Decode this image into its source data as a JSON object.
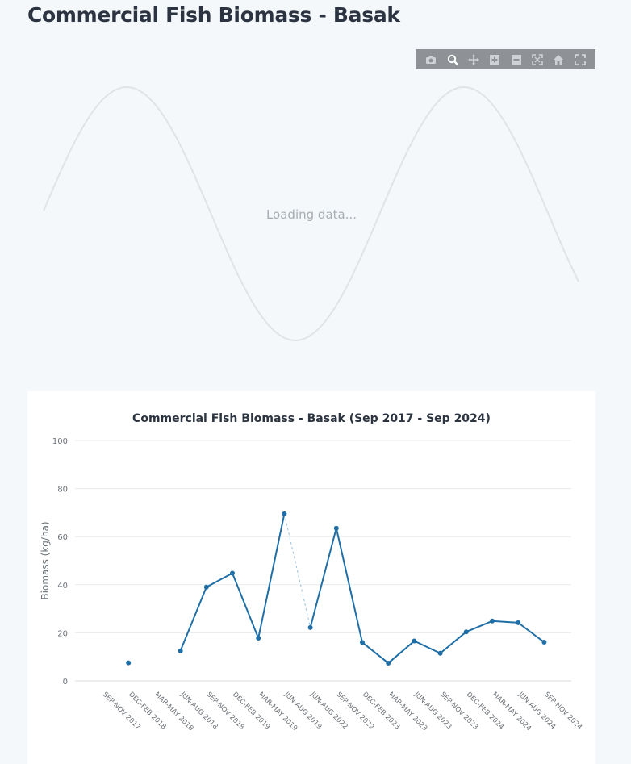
{
  "page": {
    "title": "Commercial Fish Biomass - Basak"
  },
  "loading": {
    "text": "Loading data..."
  },
  "modebar": {
    "icons": [
      "camera-icon",
      "zoom-icon",
      "pan-icon",
      "zoom-in-icon",
      "zoom-out-icon",
      "autoscale-icon",
      "home-icon",
      "fullscreen-icon"
    ],
    "background": "#8e9296",
    "active_icon_color": "#ffffff",
    "icon_color": "#cfd2d5"
  },
  "chart_data": {
    "type": "line",
    "title": "Commercial Fish Biomass - Basak (Sep 2017 - Sep 2024)",
    "xlabel": "",
    "ylabel": "Biomass (kg/ha)",
    "ylim": [
      0,
      100
    ],
    "yticks": [
      "0",
      "20",
      "40",
      "60",
      "80",
      "100"
    ],
    "grid": true,
    "color": "#1f6fa6",
    "categories": [
      "SEP-NOV 2017",
      "DEC-FEB 2018",
      "MAR-MAY 2018",
      "JUN-AUG 2018",
      "SEP-NOV 2018",
      "DEC-FEB 2019",
      "MAR-MAY 2019",
      "JUN-AUG 2019",
      "JUN-AUG 2022",
      "SEP-NOV 2022",
      "DEC-FEB 2023",
      "MAR-MAY 2023",
      "JUN-AUG 2023",
      "SEP-NOV 2023",
      "DEC-FEB 2024",
      "MAR-MAY 2024",
      "JUN-AUG 2024",
      "SEP-NOV 2024"
    ],
    "series": [
      {
        "values": [
          null,
          7.5,
          null,
          12.5,
          39,
          44.8,
          17.8,
          69.5,
          22.2,
          63.5,
          16,
          7.4,
          16.6,
          11.5,
          20.4,
          24.9,
          24.2,
          16.1
        ]
      }
    ],
    "gap_connector": {
      "from_index": 7,
      "to_index": 8,
      "style": "dashed"
    }
  }
}
